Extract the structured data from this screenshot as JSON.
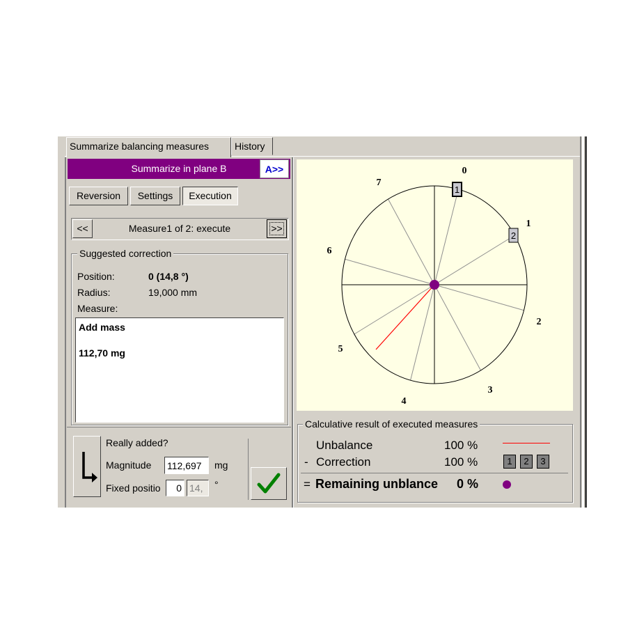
{
  "tabs": [
    {
      "label": "Summarize balancing measures",
      "active": true
    },
    {
      "label": "History",
      "active": false
    }
  ],
  "plane": {
    "title": "Summarize in plane B",
    "next_button": "A>>"
  },
  "mode_buttons": [
    "Reversion",
    "Settings",
    "Execution"
  ],
  "measure_nav": {
    "prev": "<<",
    "label": "Measure1 of 2: execute",
    "next": ">>"
  },
  "suggested": {
    "legend": "Suggested correction",
    "position_label": "Position:",
    "position_value": "0 (14,8 °)",
    "radius_label": "Radius:",
    "radius_value": "19,000 mm",
    "measure_label": "Measure:",
    "measure_line1": "Add mass",
    "measure_line2": "112,70 mg"
  },
  "confirm": {
    "question": "Really added?",
    "magnitude_label": "Magnitude",
    "magnitude_value": "112,697",
    "magnitude_unit": "mg",
    "fixed_label": "Fixed positio",
    "fixed_value": "0",
    "fixed_angle": "14,",
    "angle_unit": "°"
  },
  "result": {
    "legend": "Calculative result of executed measures",
    "unbalance_label": "Unbalance",
    "unbalance_value": "100 %",
    "minus": "-",
    "correction_label": "Correction",
    "correction_value": "100 %",
    "correction_boxes": [
      "1",
      "2",
      "3"
    ],
    "equals": "=",
    "remaining_label": "Remaining unblance",
    "remaining_value": "0 %"
  },
  "diagram": {
    "position_labels": [
      "0",
      "1",
      "2",
      "3",
      "4",
      "5",
      "6",
      "7"
    ],
    "markers": [
      "1",
      "2"
    ]
  },
  "colors": {
    "accent": "#800080",
    "vector": "#ff0000",
    "dot": "#800080",
    "check": "#008000"
  }
}
